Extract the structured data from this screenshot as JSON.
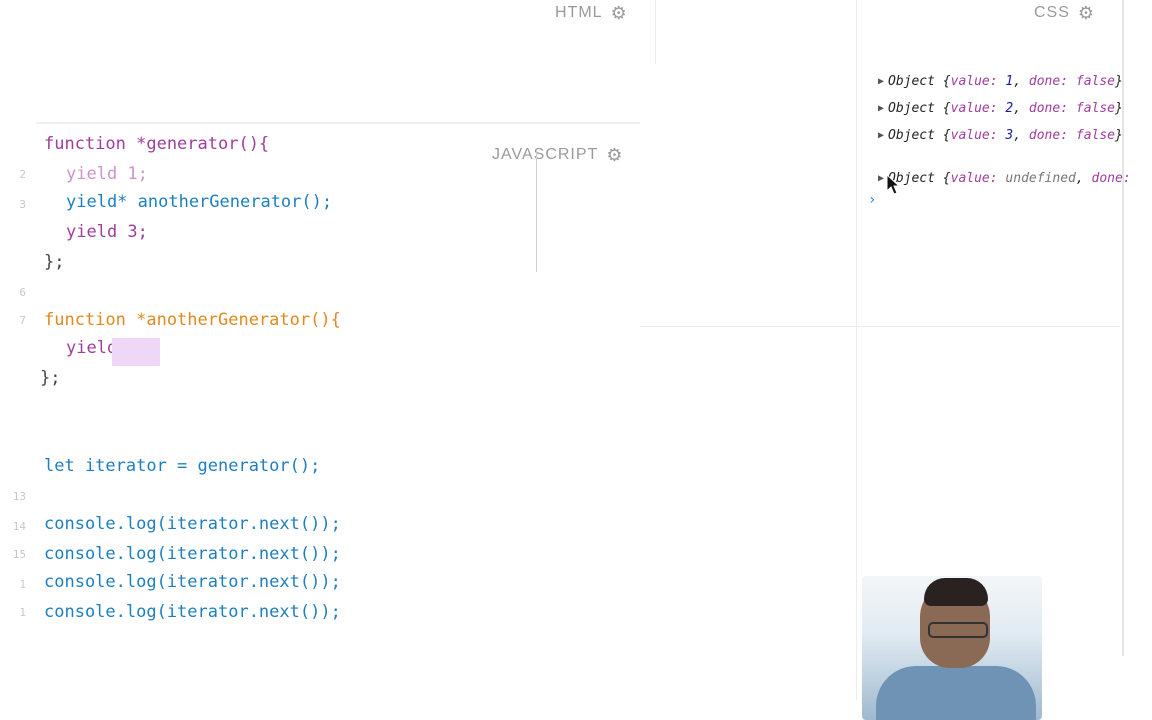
{
  "panels": {
    "html_label": "HTML",
    "css_label": "CSS",
    "js_label": "JAVASCRIPT"
  },
  "code": {
    "line_numbers": [
      "2",
      "3",
      "6",
      "7",
      "13",
      "14",
      "15",
      "1",
      "1"
    ],
    "lines": [
      {
        "text": "function *generator(){"
      },
      {
        "text": "yield 1;"
      },
      {
        "text": "yield* anotherGenerator();"
      },
      {
        "text": "yield 3;"
      },
      {
        "text": "};"
      },
      {
        "text": "function *anotherGenerator(){"
      },
      {
        "text": "yield"
      },
      {
        "text": "};"
      },
      {
        "text": "let iterator = generator();"
      },
      {
        "text": "console.log(iterator.next());"
      },
      {
        "text": "console.log(iterator.next());"
      },
      {
        "text": "console.log(iterator.next());"
      },
      {
        "text": "console.log(iterator.next());"
      }
    ]
  },
  "console": {
    "rows": [
      {
        "prefix": "Object",
        "value": "1",
        "done": "false"
      },
      {
        "prefix": "Object",
        "value": "2",
        "done": "false"
      },
      {
        "prefix": "Object",
        "value": "3",
        "done": "false"
      },
      {
        "prefix": "Object",
        "value": "undefined",
        "done": ""
      }
    ],
    "key_value": "value:",
    "key_done": "done:",
    "prompt": "›"
  }
}
